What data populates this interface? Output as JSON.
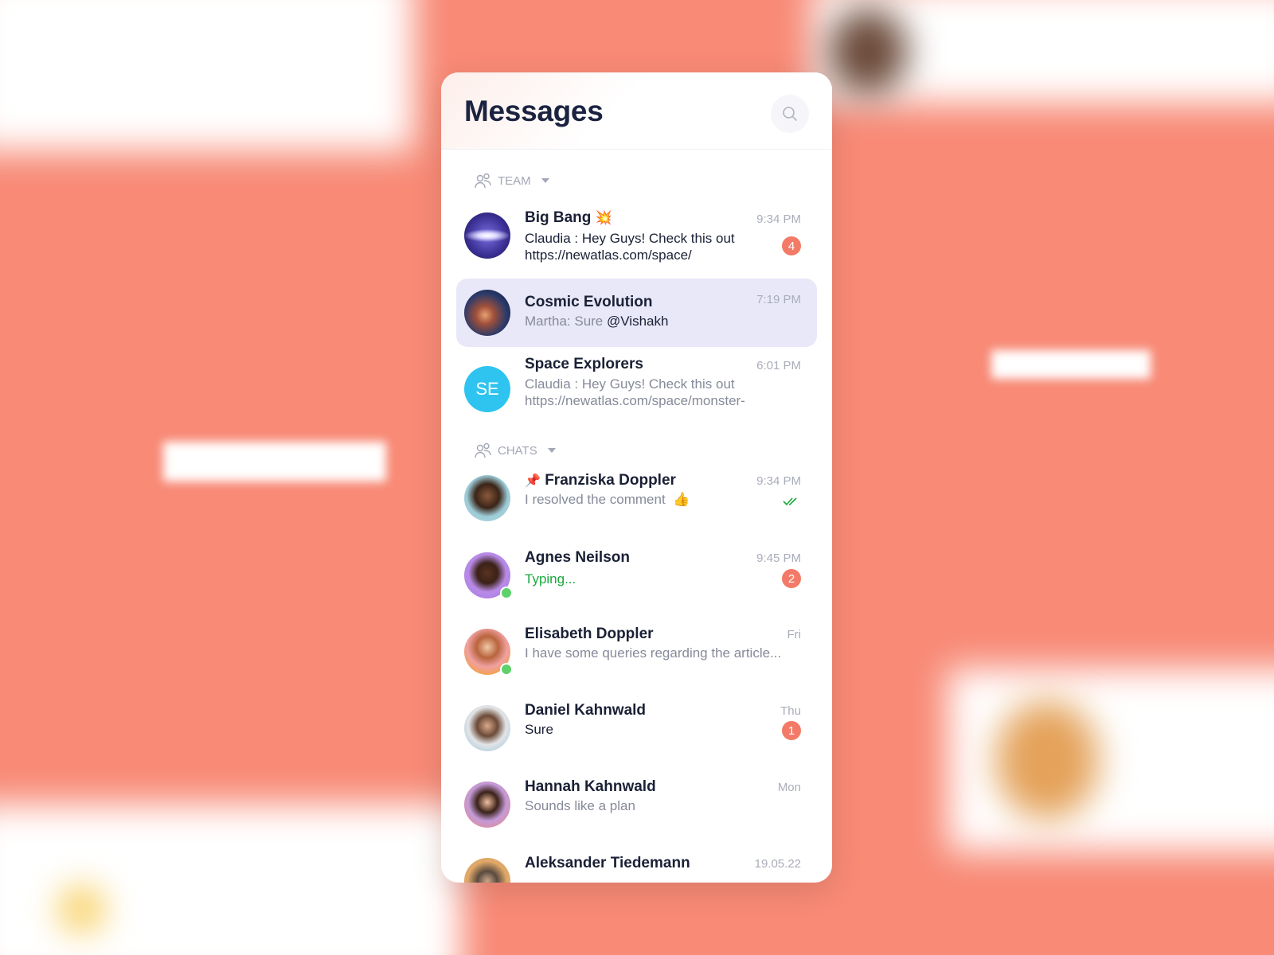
{
  "colors": {
    "background": "#F88A76",
    "accent": "#f37a67",
    "selected": "#e9e8f9",
    "online": "#5dd16a",
    "typing": "#19a83c",
    "se_avatar": "#2ec4ef"
  },
  "header": {
    "title": "Messages",
    "search_icon": "search-icon"
  },
  "sections": {
    "team": "TEAM",
    "chats": "CHATS"
  },
  "team": [
    {
      "name": "Big Bang",
      "emoji": "💥",
      "preview": "Claudia : Hey Guys! Check this out",
      "preview2": "https://newatlas.com/space/",
      "time": "9:34 PM",
      "badge": "4"
    },
    {
      "name": "Cosmic Evolution",
      "preview_prefix": "Martha: Sure ",
      "mention": "@Vishakh",
      "time": "7:19 PM",
      "selected": true
    },
    {
      "name": "Space Explorers",
      "initials": "SE",
      "preview": "Claudia : Hey Guys! Check this out",
      "preview2": "https://newatlas.com/space/monster-",
      "time": "6:01 PM"
    }
  ],
  "chats": [
    {
      "name": "Franziska Doppler",
      "pinned_icon": "📌",
      "preview": "I resolved the comment",
      "emoji": "👍",
      "time": "9:34 PM",
      "read": true
    },
    {
      "name": "Agnes Neilson",
      "preview": "Typing...",
      "time": "9:45 PM",
      "badge": "2",
      "online": true
    },
    {
      "name": "Elisabeth Doppler",
      "preview": "I have some queries regarding the article...",
      "time": "Fri",
      "online": true
    },
    {
      "name": "Daniel Kahnwald",
      "preview": "Sure",
      "time": "Thu",
      "badge": "1"
    },
    {
      "name": "Hannah Kahnwald",
      "preview": "Sounds like a plan",
      "time": "Mon"
    },
    {
      "name": "Aleksander Tiedemann",
      "time": "19.05.22"
    }
  ]
}
